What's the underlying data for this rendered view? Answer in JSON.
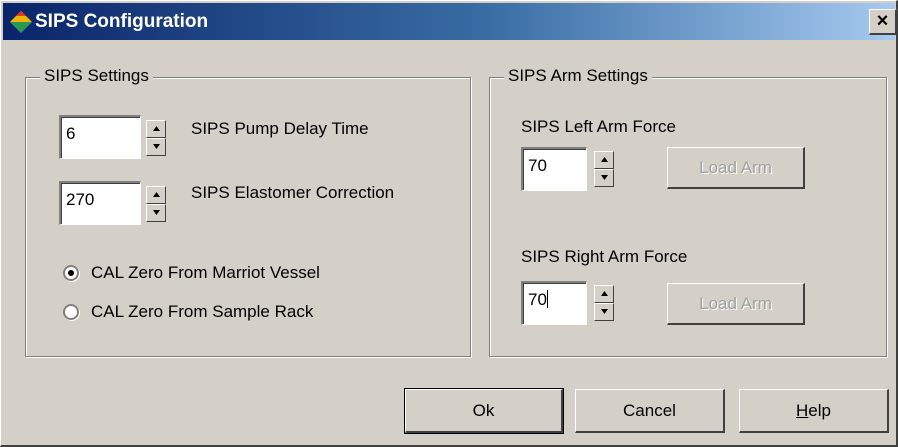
{
  "window": {
    "title": "SIPS Configuration",
    "close_label": "×"
  },
  "sips_settings": {
    "legend": "SIPS Settings",
    "pump_delay": {
      "value": "6",
      "label": "SIPS Pump Delay Time"
    },
    "elastomer": {
      "value": "270",
      "label": "SIPS Elastomer Correction"
    },
    "radios": [
      {
        "label": "CAL Zero From Marriot Vessel",
        "checked": true
      },
      {
        "label": "CAL Zero From Sample Rack",
        "checked": false
      }
    ]
  },
  "arm_settings": {
    "legend": "SIPS Arm Settings",
    "left": {
      "label": "SIPS Left Arm Force",
      "value": "70",
      "button": "Load Arm"
    },
    "right": {
      "label": "SIPS Right Arm Force",
      "value": "70",
      "button": "Load Arm"
    }
  },
  "footer": {
    "ok": "Ok",
    "cancel": "Cancel",
    "help_mnemonic": "H",
    "help_rest": "elp"
  }
}
